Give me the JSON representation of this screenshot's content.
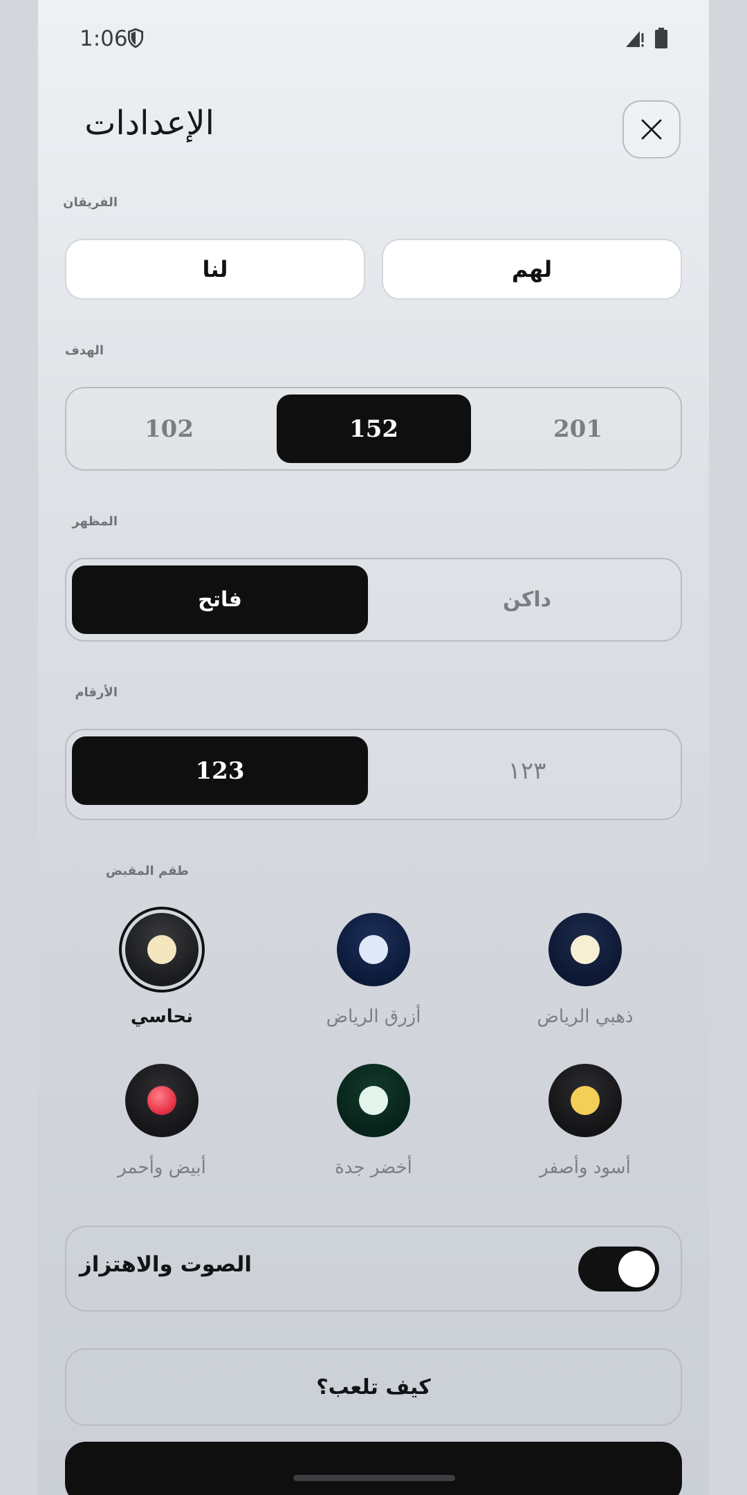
{
  "status_bar": {
    "time": "1:06"
  },
  "header": {
    "title": "الإعدادات"
  },
  "teams": {
    "label": "الفريقان",
    "us": "لنا",
    "them": "لهم"
  },
  "target": {
    "label": "الهدف",
    "options": [
      "102",
      "152",
      "201"
    ],
    "selected": "152"
  },
  "appearance": {
    "label": "المظهر",
    "options": [
      "فاتح",
      "داكن"
    ],
    "selected": "فاتح"
  },
  "numerals": {
    "label": "الأرقام",
    "options": [
      "123",
      "١٢٣"
    ],
    "selected": "123"
  },
  "skins": {
    "label": "طقم المقبض",
    "items": [
      {
        "name": "نحاسي",
        "body": "#1a1b1d",
        "dot": "#f4e7c0",
        "selected": true
      },
      {
        "name": "أزرق الرياض",
        "body": "#0c1a3a",
        "dot": "#dfe9f7",
        "selected": false
      },
      {
        "name": "ذهبي الرياض",
        "body": "#0d1832",
        "dot": "#f6efd4",
        "selected": false
      },
      {
        "name": "أبيض وأحمر",
        "body": "#161618",
        "dot": "#e8374a",
        "selected": false
      },
      {
        "name": "أخضر جدة",
        "body": "#07231a",
        "dot": "#e3f4ea",
        "selected": false
      },
      {
        "name": "أسود وأصفر",
        "body": "#141416",
        "dot": "#f3cf58",
        "selected": false
      }
    ]
  },
  "sound": {
    "label": "الصوت والاهتزاز",
    "enabled": true
  },
  "how_to_play": {
    "label": "كيف تلعب؟"
  }
}
